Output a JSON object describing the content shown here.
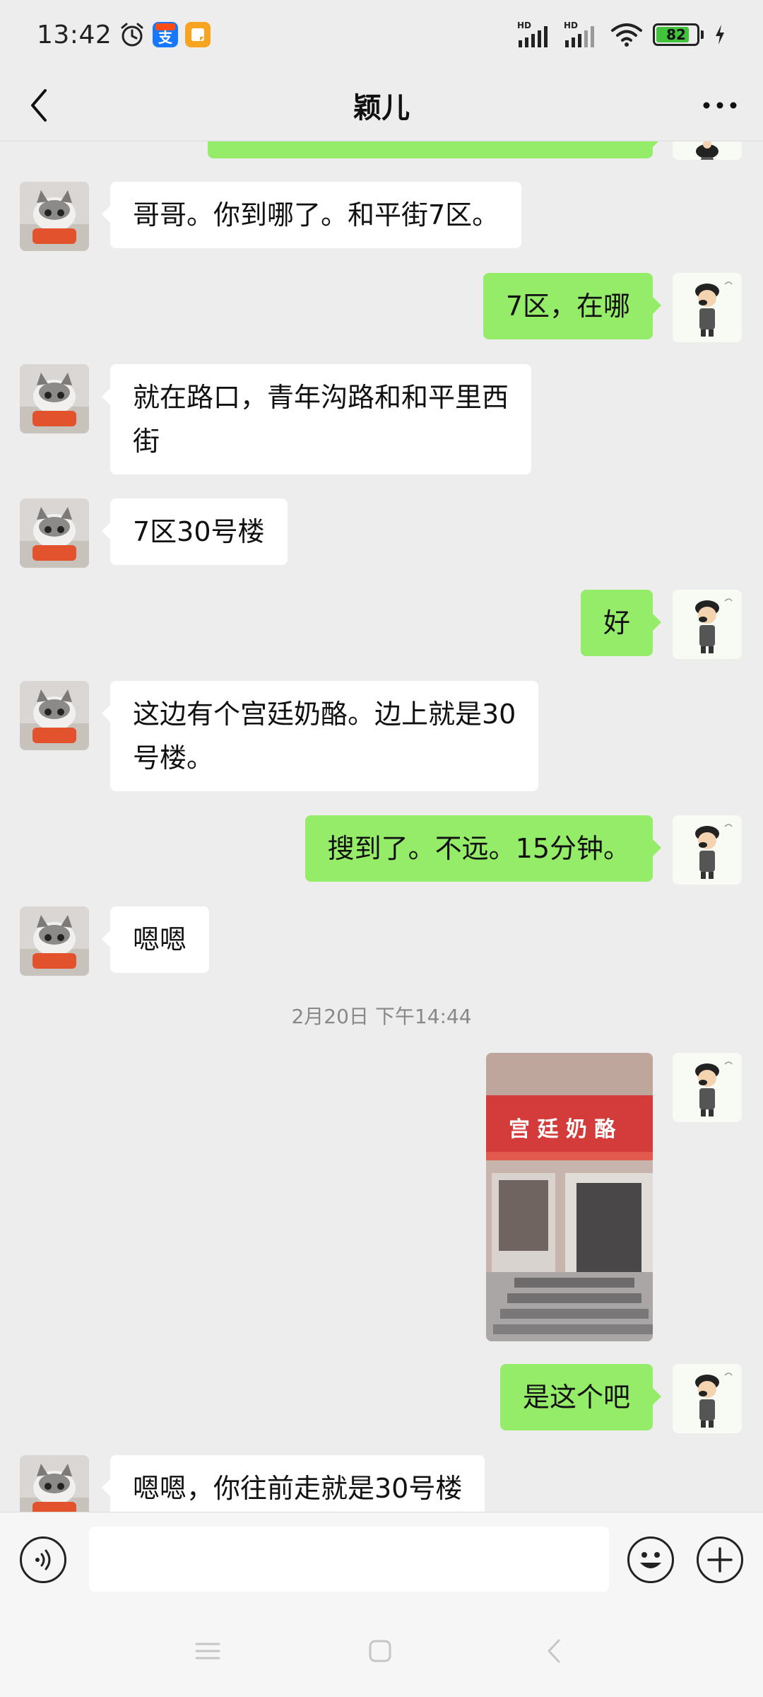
{
  "status_bar": {
    "time": "13:42",
    "alarm_icon": "alarm-clock-icon",
    "apps": [
      "taobao-alipay-icon",
      "orange-app-icon"
    ],
    "network_labels": [
      "HD",
      "HD"
    ],
    "battery": "82",
    "battery_level": 0.82,
    "colors": {
      "battery_fill": "#41c43b"
    }
  },
  "header": {
    "title": "颖儿",
    "back_icon": "chevron-left-icon",
    "more_icon": "more-dots-icon"
  },
  "messages": [
    {
      "side": "recv",
      "text": "哥哥。你到哪了。和平街7区。"
    },
    {
      "side": "sent",
      "text": "7区，在哪"
    },
    {
      "side": "recv",
      "text": "就在路口，青年沟路和和平里西\n街"
    },
    {
      "side": "recv",
      "text": "7区30号楼"
    },
    {
      "side": "sent",
      "text": "好"
    },
    {
      "side": "recv",
      "text": "这边有个宫廷奶酪。边上就是30\n号楼。"
    },
    {
      "side": "sent",
      "text": "搜到了。不远。15分钟。"
    },
    {
      "side": "recv",
      "text": "嗯嗯"
    },
    {
      "side": "time",
      "text": "2月20日 下午14:44"
    },
    {
      "side": "sent",
      "type": "image",
      "sign_text": "宫 廷 奶 酪"
    },
    {
      "side": "sent",
      "text": "是这个吧"
    },
    {
      "side": "recv",
      "text": "嗯嗯，你往前走就是30号楼"
    }
  ],
  "input_bar": {
    "voice_icon": "voice-icon",
    "input_value": "",
    "emoji_icon": "emoji-icon",
    "plus_icon": "plus-icon"
  },
  "nav": {
    "menu_icon": "menu-icon",
    "home_icon": "home-icon",
    "back_icon": "back-icon"
  },
  "colors": {
    "background": "#ededed",
    "sent_bubble": "#95ec69",
    "recv_bubble": "#ffffff"
  }
}
